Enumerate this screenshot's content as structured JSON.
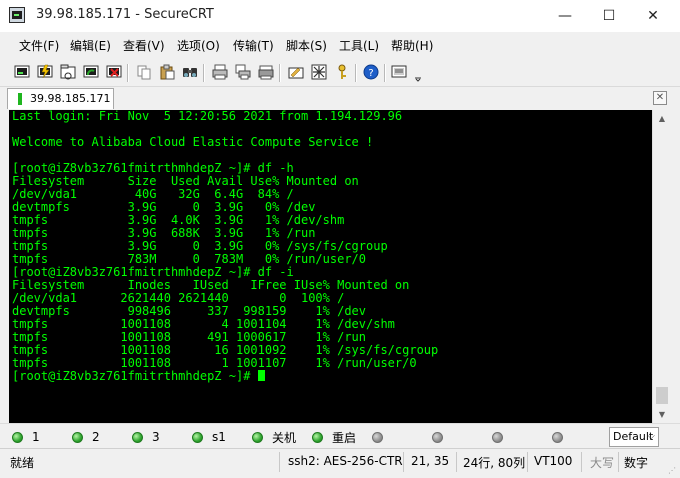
{
  "window": {
    "title": "39.98.185.171 - SecureCRT",
    "minimize_glyph": "—",
    "maximize_glyph": "☐",
    "close_glyph": "✕"
  },
  "menu": [
    "文件(F)",
    "编辑(E)",
    "查看(V)",
    "选项(O)",
    "传输(T)",
    "脚本(S)",
    "工具(L)",
    "帮助(H)"
  ],
  "toolbar": {
    "icons": [
      "connect-icon",
      "quick-connect-icon",
      "connect-in-tab-icon",
      "reconnect-icon",
      "disconnect-icon",
      "copy-icon",
      "paste-icon",
      "find-icon",
      "print-icon",
      "print-selection-icon",
      "print-setup-icon",
      "session-options-icon",
      "global-options-icon",
      "keymap-icon",
      "help-icon",
      "log-session-icon",
      "toolbar-overflow-icon"
    ]
  },
  "tabs": [
    {
      "label": "39.98.185.171",
      "status_color": "#1fb51f"
    }
  ],
  "tab_close_glyph": "✕",
  "terminal": {
    "foreground": "#00ff00",
    "background": "#000000",
    "lines": [
      "Last login: Fri Nov  5 12:20:56 2021 from 1.194.129.96",
      "",
      "Welcome to Alibaba Cloud Elastic Compute Service !",
      "",
      "[root@iZ8vb3z761fmitrthmhdepZ ~]# df -h",
      "Filesystem      Size  Used Avail Use% Mounted on",
      "/dev/vda1        40G   32G  6.4G  84% /",
      "devtmpfs        3.9G     0  3.9G   0% /dev",
      "tmpfs           3.9G  4.0K  3.9G   1% /dev/shm",
      "tmpfs           3.9G  688K  3.9G   1% /run",
      "tmpfs           3.9G     0  3.9G   0% /sys/fs/cgroup",
      "tmpfs           783M     0  783M   0% /run/user/0",
      "[root@iZ8vb3z761fmitrthmhdepZ ~]# df -i",
      "Filesystem      Inodes   IUsed   IFree IUse% Mounted on",
      "/dev/vda1      2621440 2621440       0  100% /",
      "devtmpfs        998496     337  998159    1% /dev",
      "tmpfs          1001108       4 1001104    1% /dev/shm",
      "tmpfs          1001108     491 1000617    1% /run",
      "tmpfs          1001108      16 1001092    1% /sys/fs/cgroup",
      "tmpfs          1001108       1 1001107    1% /run/user/0",
      "[root@iZ8vb3z761fmitrthmhdepZ ~]# "
    ]
  },
  "scrollbar": {
    "up_glyph": "▲",
    "down_glyph": "▼"
  },
  "buttonbar": {
    "buttons": [
      {
        "label": "1",
        "state": "on"
      },
      {
        "label": "2",
        "state": "on"
      },
      {
        "label": "3",
        "state": "on"
      },
      {
        "label": "s1",
        "state": "on"
      },
      {
        "label": "关机",
        "state": "on"
      },
      {
        "label": "重启",
        "state": "on"
      },
      {
        "label": "",
        "state": "off"
      },
      {
        "label": "",
        "state": "off"
      },
      {
        "label": "",
        "state": "off"
      },
      {
        "label": "",
        "state": "off"
      }
    ],
    "session_select": "Default",
    "select_arrow": "⌵"
  },
  "statusbar": {
    "ready": "就绪",
    "cipher": "ssh2: AES-256-CTR",
    "cursor_pos": "21,  35",
    "size": "24行, 80列",
    "terminal_type": "VT100",
    "caps": "大写",
    "num": "数字"
  }
}
